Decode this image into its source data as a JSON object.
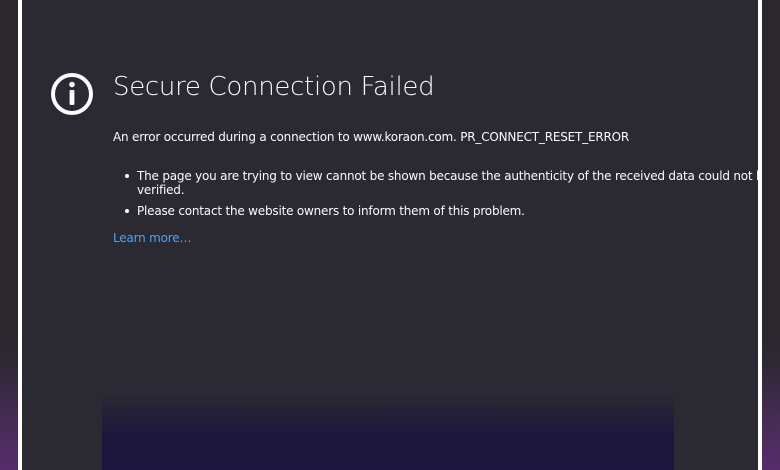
{
  "error_page": {
    "icon": "info-icon",
    "title": "Secure Connection Failed",
    "description": "An error occurred during a connection to www.koraon.com. PR_CONNECT_RESET_ERROR",
    "bullets": [
      "The page you are trying to view cannot be shown because the authenticity of the received data could not be verified.",
      "Please contact the website owners to inform them of this problem."
    ],
    "learn_more_label": "Learn more…"
  },
  "colors": {
    "panel_background": "#2b2a33",
    "text": "#fbfbfe",
    "link": "#4aa3f5",
    "frame": "#ffffff"
  }
}
